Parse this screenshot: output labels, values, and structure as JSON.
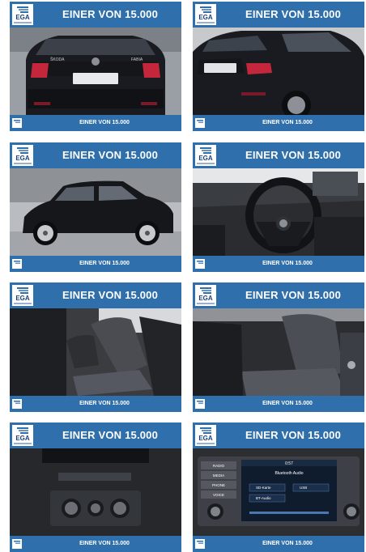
{
  "tiles": [
    {
      "header": "EINER VON 15.000",
      "footer": "EINER VON 15.000",
      "logo": "EGA",
      "photo": "rear-view"
    },
    {
      "header": "EINER VON 15.000",
      "footer": "EINER VON 15.000",
      "logo": "EGA",
      "photo": "rear-three-quarter-view"
    },
    {
      "header": "EINER VON 15.000",
      "footer": "EINER VON 15.000",
      "logo": "EGA",
      "photo": "side-view"
    },
    {
      "header": "EINER VON 15.000",
      "footer": "EINER VON 15.000",
      "logo": "EGA",
      "photo": "cockpit-steering-wheel"
    },
    {
      "header": "EINER VON 15.000",
      "footer": "EINER VON 15.000",
      "logo": "EGA",
      "photo": "front-seats"
    },
    {
      "header": "EINER VON 15.000",
      "footer": "EINER VON 15.000",
      "logo": "EGA",
      "photo": "passenger-seat"
    },
    {
      "header": "EINER VON 15.000",
      "footer": "EINER VON 15.000",
      "logo": "EGA",
      "photo": "climate-controls"
    },
    {
      "header": "EINER VON 15.000",
      "footer": "EINER VON 15.000",
      "logo": "EGA",
      "photo": "infotainment-screen"
    }
  ],
  "infotainment": {
    "screen_title": "Bluetooth Audio",
    "buttons": [
      "RADIO",
      "MEDIA",
      "PHONE",
      "VOICE"
    ],
    "sources": [
      "SD-Karte",
      "USB",
      "BT-Audio"
    ],
    "time": "0:57"
  },
  "car_badges": {
    "brand": "ŠKODA",
    "model": "FABIA"
  },
  "colors": {
    "brand_blue": "#2f6fab",
    "logo_text": "#1c3f7a",
    "background": "#ffffff"
  }
}
